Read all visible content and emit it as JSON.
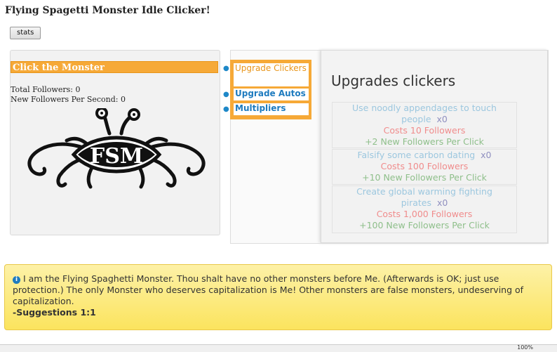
{
  "page": {
    "title": "Flying Spagetti Monster Idle Clicker!",
    "stats_button": "stats"
  },
  "left": {
    "header": "Click the Monster",
    "total_followers": "Total Followers: 0",
    "new_followers_per_second": "New Followers Per Second: 0",
    "logo_text": "FSM"
  },
  "menu": {
    "items": [
      "Upgrade Clickers",
      "Upgrade Autos",
      "Multipliers"
    ]
  },
  "upgrades": {
    "title": "Upgrades clickers",
    "items": [
      {
        "name": "Use noodly appendages to touch people",
        "count": "x0",
        "cost": "Costs 10 Followers",
        "gain": "+2 New Followers Per Click"
      },
      {
        "name": "Falsify some carbon dating",
        "count": "x0",
        "cost": "Costs 100 Followers",
        "gain": "+10 New Followers Per Click"
      },
      {
        "name": "Create global warming fighting pirates",
        "count": "x0",
        "cost": "Costs 1,000 Followers",
        "gain": "+100 New Followers Per Click"
      }
    ]
  },
  "alert": {
    "message": "I am the Flying Spaghetti Monster. Thou shalt have no other monsters before Me. (Afterwards is OK; just use protection.) The only Monster who deserves capitalization is Me! Other monsters are false monsters, undeserving of capitalization.",
    "signature": "-Suggestions 1:1"
  },
  "status_bar": {
    "zoom": "100%"
  },
  "colors": {
    "accent_orange": "#f6a937",
    "link_blue": "#1e7bbf",
    "alert_yellow": "#fbe45e"
  }
}
